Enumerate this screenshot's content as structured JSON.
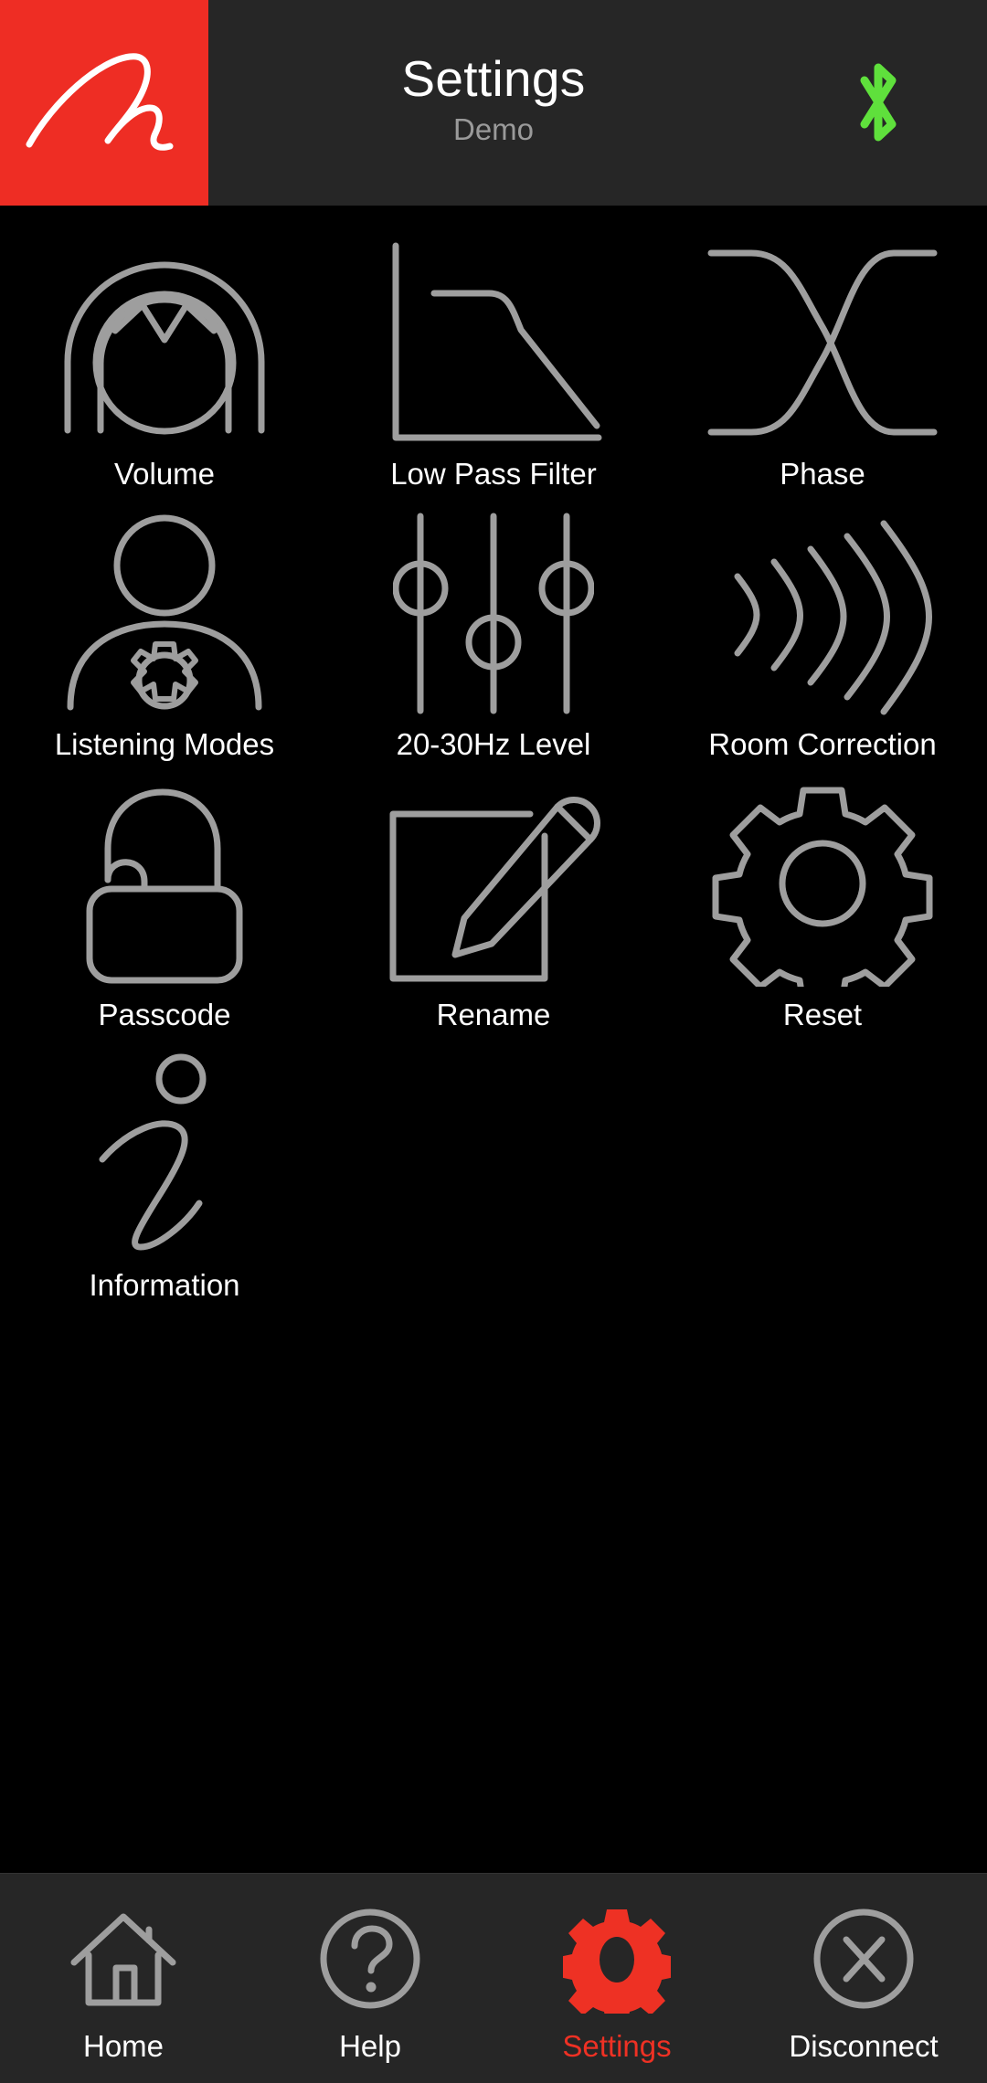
{
  "header": {
    "logo_name": "brand-script-logo",
    "logo_bg_color": "#EE2D24",
    "title": "Settings",
    "subtitle": "Demo",
    "bluetooth_icon": "bluetooth-icon",
    "bluetooth_color": "#5FE03C",
    "background_color": "#262626"
  },
  "grid": {
    "items": [
      {
        "label": "Volume",
        "icon": "volume-icon"
      },
      {
        "label": "Low Pass Filter",
        "icon": "low-pass-filter-icon"
      },
      {
        "label": "Phase",
        "icon": "phase-crossover-icon"
      },
      {
        "label": "Listening Modes",
        "icon": "listening-modes-icon"
      },
      {
        "label": "20-30Hz Level",
        "icon": "sliders-icon"
      },
      {
        "label": "Room Correction",
        "icon": "sound-waves-icon"
      },
      {
        "label": "Passcode",
        "icon": "open-padlock-icon"
      },
      {
        "label": "Rename",
        "icon": "pencil-edit-icon"
      },
      {
        "label": "Reset",
        "icon": "gear-icon"
      },
      {
        "label": "Information",
        "icon": "info-script-i-icon"
      }
    ],
    "icon_color": "#9e9e9e",
    "label_color": "#ffffff",
    "background_color": "#000000"
  },
  "tabbar": {
    "background_color": "#262626",
    "active_color": "#EE3124",
    "items": [
      {
        "label": "Home",
        "icon": "home-icon",
        "active": false
      },
      {
        "label": "Help",
        "icon": "question-mark-circle-icon",
        "active": false
      },
      {
        "label": "Settings",
        "icon": "gear-icon",
        "active": true
      },
      {
        "label": "Disconnect",
        "icon": "close-circle-icon",
        "active": false
      }
    ]
  }
}
